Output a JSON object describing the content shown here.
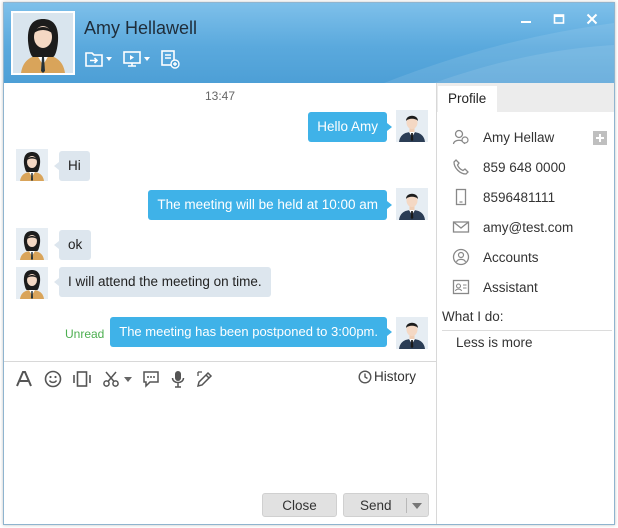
{
  "header": {
    "contact_name": "Amy Hellawell",
    "tools": [
      "transfer-file-icon",
      "screen-share-icon",
      "add-contact-icon"
    ],
    "window_controls": [
      "close-icon",
      "maximize-icon",
      "minimize-icon"
    ]
  },
  "chat": {
    "timestamp": "13:47",
    "messages": [
      {
        "direction": "out",
        "text": "Hello Amy"
      },
      {
        "direction": "in",
        "text": "Hi"
      },
      {
        "direction": "out",
        "text": "The meeting will be held at 10:00 am"
      },
      {
        "direction": "in",
        "text": "ok"
      },
      {
        "direction": "in",
        "text": "I will attend the meeting on time."
      },
      {
        "direction": "out",
        "text": "The meeting has been postponed to 3:00pm.",
        "status": "Unread"
      }
    ]
  },
  "input_toolbar": {
    "tools": [
      "font-icon",
      "emoji-icon",
      "shake-icon",
      "screenshot-icon",
      "quick-reply-icon",
      "voice-icon",
      "edit-icon"
    ],
    "history_label": "History"
  },
  "compose": {
    "value": ""
  },
  "buttons": {
    "close_label": "Close",
    "send_label": "Send"
  },
  "profile": {
    "tab_label": "Profile",
    "name": "Amy Hellaw",
    "phone": "859 648 0000",
    "mobile": "8596481111",
    "email": "amy@test.com",
    "accounts_label": "Accounts",
    "assistant_label": "Assistant",
    "what_i_do_label": "What I do:",
    "what_i_do": "Less is more"
  },
  "colors": {
    "titlebar": "#5aa9dd",
    "outgoing_bubble": "#3fb2e8",
    "incoming_bubble": "#dde6ee",
    "unread": "#4caf50"
  }
}
